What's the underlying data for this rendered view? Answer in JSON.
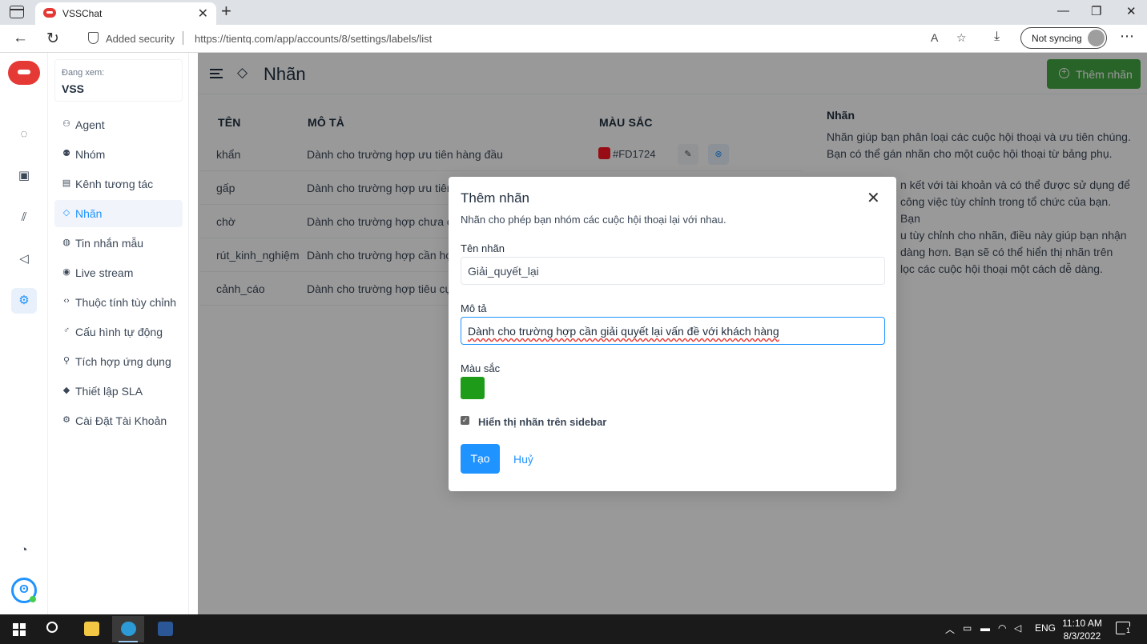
{
  "browser": {
    "tab_title": "VSSChat",
    "security_label": "Added security",
    "url": "https://tientq.com/app/accounts/8/settings/labels/list",
    "sync_label": "Not syncing"
  },
  "sidebar": {
    "viewing_caption": "Đang xem:",
    "account_name": "VSS",
    "items": [
      {
        "label": "Agent",
        "icon": "users-icon"
      },
      {
        "label": "Nhóm",
        "icon": "team-icon"
      },
      {
        "label": "Kênh tương tác",
        "icon": "inbox-icon"
      },
      {
        "label": "Nhãn",
        "icon": "tag-icon",
        "active": true
      },
      {
        "label": "Tin nhắn mẫu",
        "icon": "chat-template-icon"
      },
      {
        "label": "Live stream",
        "icon": "broadcast-icon"
      },
      {
        "label": "Thuộc tính tùy chỉnh",
        "icon": "code-icon"
      },
      {
        "label": "Cấu hình tự động",
        "icon": "automation-icon"
      },
      {
        "label": "Tích hợp ứng dụng",
        "icon": "plug-icon"
      },
      {
        "label": "Thiết lập SLA",
        "icon": "sla-icon"
      },
      {
        "label": "Cài Đặt Tài Khoản",
        "icon": "settings-icon"
      }
    ]
  },
  "header": {
    "title": "Nhãn",
    "add_button": "Thêm nhãn"
  },
  "table": {
    "columns": [
      "TÊN",
      "MÔ TẢ",
      "MÀU SẮC"
    ],
    "rows": [
      {
        "name": "khẩn",
        "description": "Dành cho trường hợp ưu tiên hàng đầu",
        "color": "#FD1724"
      },
      {
        "name": "gấp",
        "description": "Dành cho trường hợp ưu tiên s"
      },
      {
        "name": "chờ",
        "description": "Dành cho trường hợp chưa cấp"
      },
      {
        "name": "rút_kinh_nghiệm",
        "description": "Dành cho trường hợp cần họp"
      },
      {
        "name": "cảnh_cáo",
        "description": "Dành cho trường hợp tiêu cực"
      }
    ]
  },
  "info": {
    "title": "Nhãn",
    "paragraph1": "Nhãn giúp bạn phân loại các cuộc hội thoại và ưu tiên chúng. Bạn có thể gán nhãn cho một cuộc hội thoại từ bảng phụ.",
    "paragraph2_lines": [
      "n kết với tài khoản và có thể được sử dụng để",
      "công việc tùy chỉnh trong tổ chức của bạn. Bạn",
      "u tùy chỉnh cho nhãn, điều này giúp bạn nhận",
      "dàng hơn. Bạn sẽ có thể hiển thị nhãn trên",
      "lọc các cuộc hội thoại một cách dễ dàng."
    ]
  },
  "modal": {
    "title": "Thêm nhãn",
    "subtitle": "Nhãn cho phép bạn nhóm các cuộc hội thoại lại với nhau.",
    "name_label": "Tên nhãn",
    "name_value": "Giải_quyết_lại",
    "description_label": "Mô tả",
    "description_value": "Dành cho trường hợp cần giải quyết lại vấn đề với khách hàng",
    "color_label": "Màu sắc",
    "selected_color": "#1e9b18",
    "show_in_sidebar_label": "Hiển thị nhãn trên sidebar",
    "show_in_sidebar_checked": true,
    "create_button": "Tạo",
    "cancel_button": "Huỷ"
  },
  "taskbar": {
    "language": "ENG",
    "time": "11:10 AM",
    "date": "8/3/2022",
    "notification_count": "1"
  }
}
